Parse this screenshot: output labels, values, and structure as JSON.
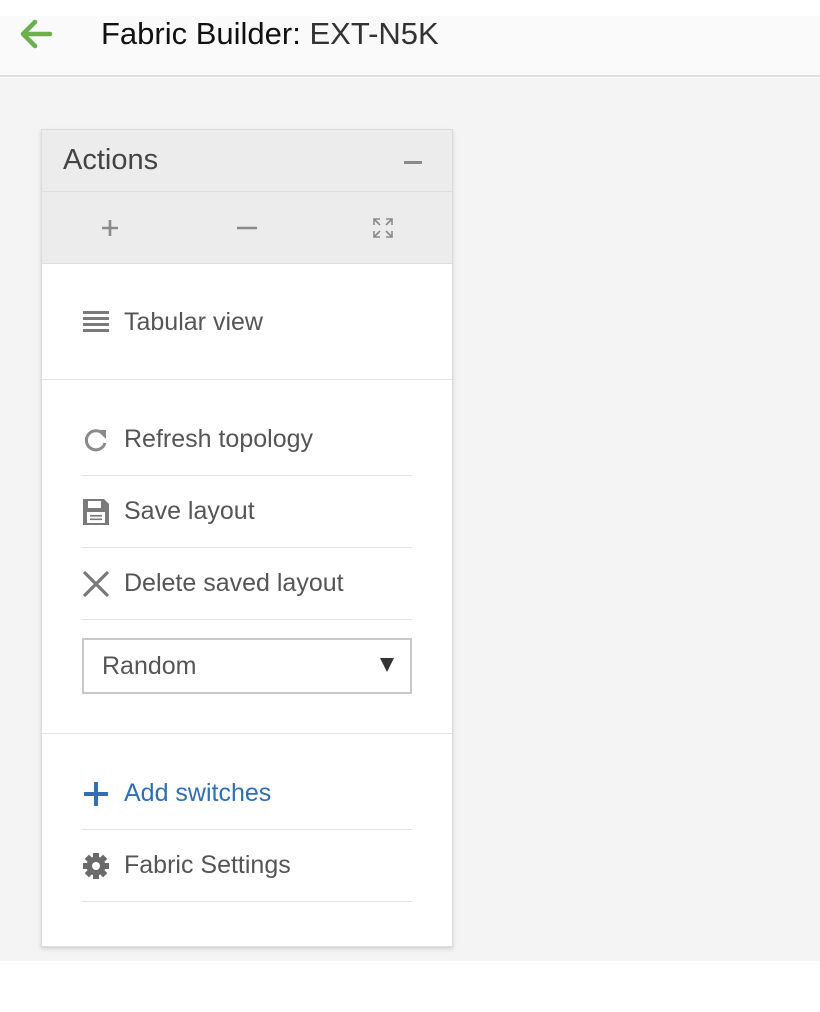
{
  "header": {
    "title_label": "Fabric Builder:",
    "title_name": "EXT-N5K",
    "back_icon": "arrow-left-icon",
    "accent_color": "#6ab04c"
  },
  "panel": {
    "title": "Actions",
    "collapse_icon": "minus-icon",
    "zoom": {
      "zoom_in_icon": "plus-icon",
      "zoom_out_icon": "minus-icon",
      "fit_icon": "expand-icon"
    },
    "tabular": {
      "label": "Tabular view",
      "icon": "list-icon"
    },
    "refresh": {
      "label": "Refresh topology",
      "icon": "refresh-icon"
    },
    "save": {
      "label": "Save layout",
      "icon": "floppy-disk-icon"
    },
    "delete": {
      "label": "Delete saved layout",
      "icon": "close-icon"
    },
    "layout_select": {
      "value": "Random"
    },
    "add_switches": {
      "label": "Add switches",
      "icon": "plus-icon",
      "color": "#2e6fb5"
    },
    "settings": {
      "label": "Fabric Settings",
      "icon": "gear-icon"
    }
  }
}
